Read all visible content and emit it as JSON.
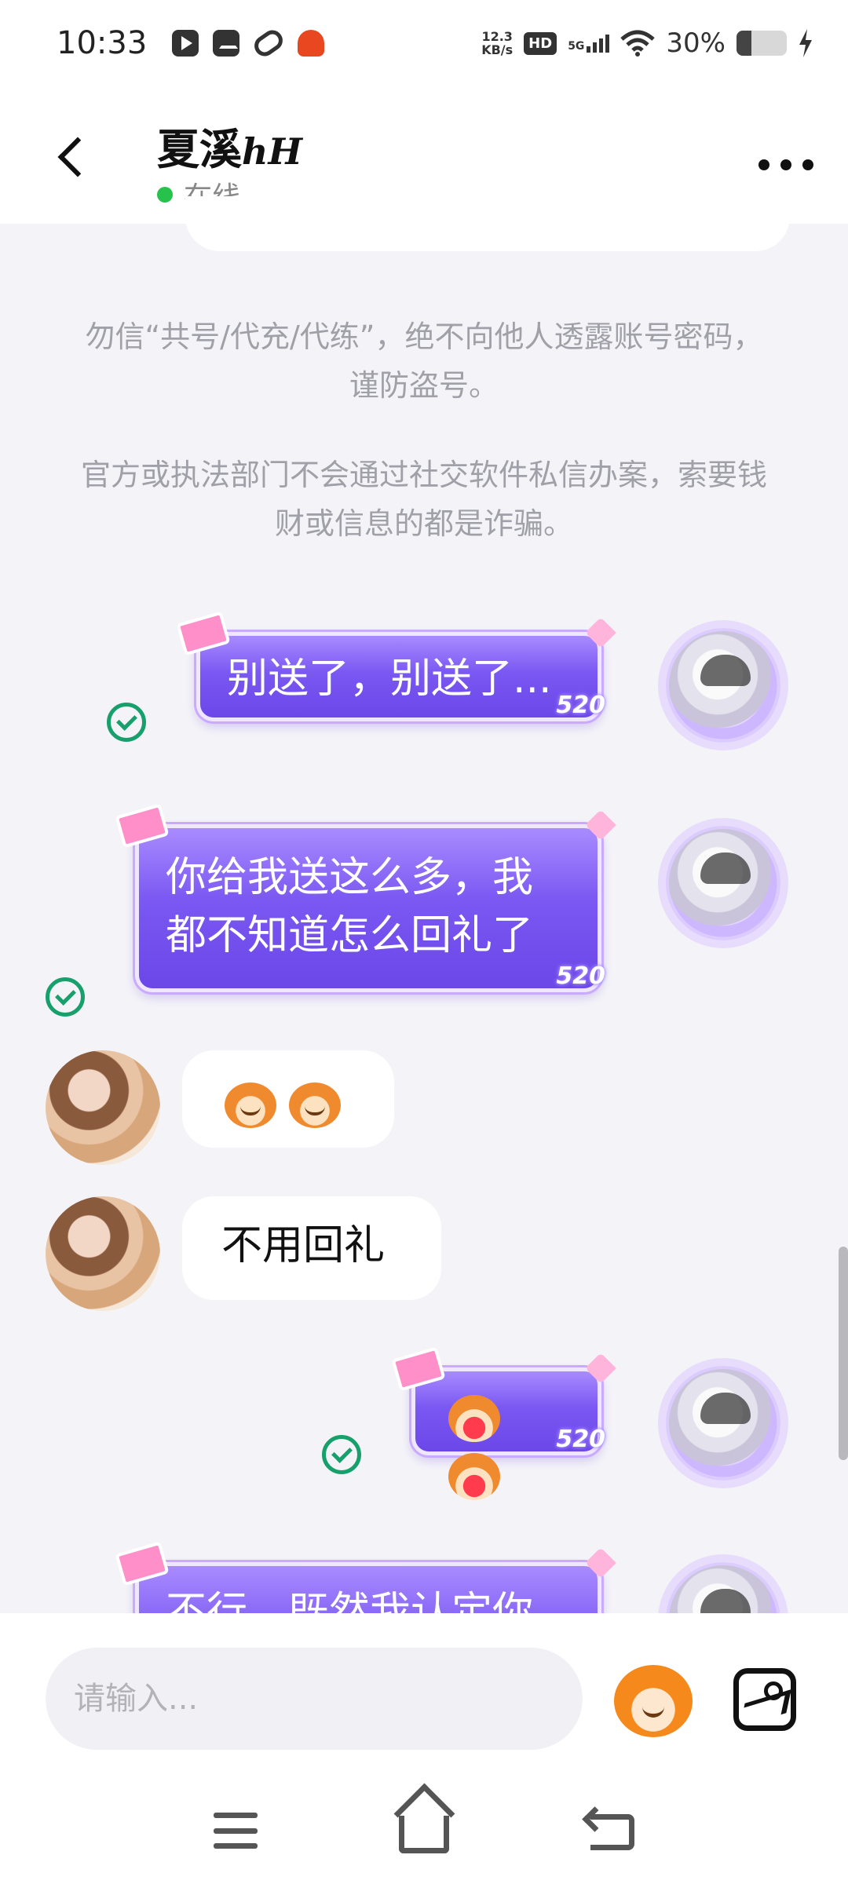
{
  "status_bar": {
    "time": "10:33",
    "net_speed_value": "12.3",
    "net_speed_unit": "KB/s",
    "hd": "HD",
    "network": "5G",
    "battery": "30%",
    "battery_level": 0.3,
    "icons": [
      "play-icon",
      "message-icon",
      "link-icon",
      "robot-icon",
      "wifi-icon",
      "signal-icon",
      "battery-icon",
      "charging-icon"
    ]
  },
  "header": {
    "name": "夏溪",
    "name_suffix": "hH",
    "status": "在线",
    "status_color": "#27c24c"
  },
  "notices": [
    "勿信“共号/代充/代练”，绝不向他人透露账号密码，谨防盗号。",
    "官方或执法部门不会通过社交软件私信办案，索要钱财或信息的都是诈骗。"
  ],
  "messages": [
    {
      "from": "me",
      "text": "别送了，别送了..."
    },
    {
      "from": "me",
      "text": "你给我送这么多，我都不知道怎么回礼了"
    },
    {
      "from": "her",
      "type": "emoji",
      "emojis": [
        "monkey-emoji",
        "monkey-emoji"
      ]
    },
    {
      "from": "her",
      "text": "不用回礼"
    },
    {
      "from": "me",
      "type": "emoji",
      "emojis": [
        "heart-monkey-emoji",
        "heart-monkey-emoji"
      ]
    },
    {
      "from": "me",
      "text": "不行，既然我认定你"
    }
  ],
  "bubble_tag": "520",
  "input": {
    "placeholder": "请输入..."
  },
  "colors": {
    "bubble_out": "#7a58f2",
    "read_check": "#18a06c",
    "background": "#f4f4f8"
  }
}
